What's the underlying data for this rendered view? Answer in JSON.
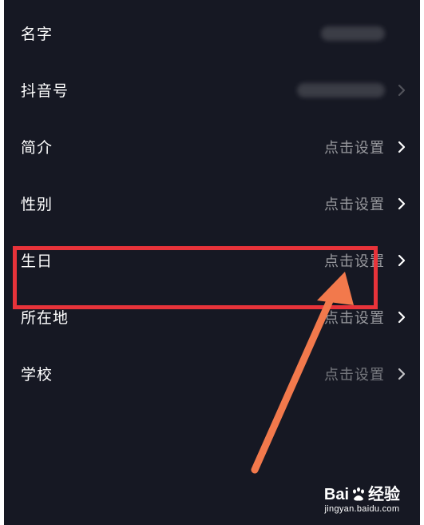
{
  "profile_rows": [
    {
      "label": "名字",
      "value": "",
      "value_hidden": true
    },
    {
      "label": "抖音号",
      "value": "",
      "value_hidden": true
    },
    {
      "label": "简介",
      "value": "点击设置"
    },
    {
      "label": "性别",
      "value": "点击设置"
    },
    {
      "label": "生日",
      "value": "点击设置"
    },
    {
      "label": "所在地",
      "value": "点击设置"
    },
    {
      "label": "学校",
      "value": "点击设置"
    }
  ],
  "watermark": {
    "brand_left": "Bai",
    "brand_right": "经验",
    "url": "jingyan.baidu.com"
  },
  "colors": {
    "background": "#161823",
    "highlight": "#e8333a",
    "arrow": "#f2794c"
  }
}
